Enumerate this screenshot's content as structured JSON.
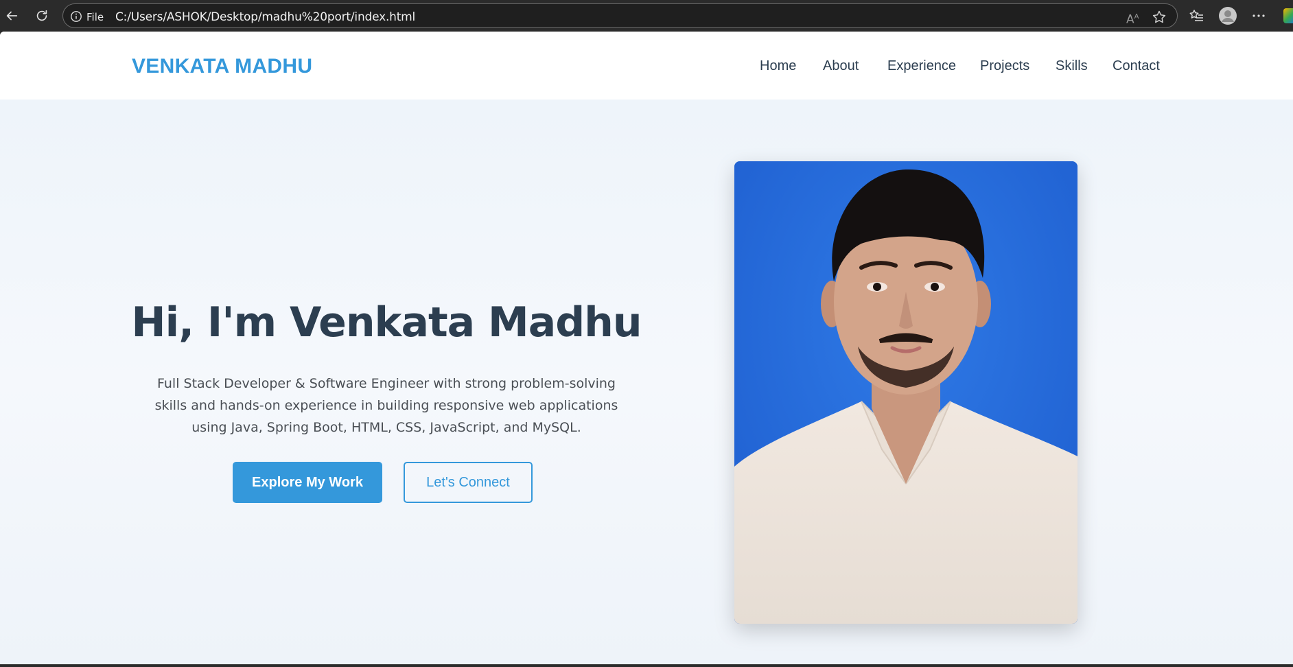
{
  "browser": {
    "file_label": "File",
    "url": "C:/Users/ASHOK/Desktop/madhu%20port/index.html",
    "read_aloud_label": "A",
    "read_aloud_sup": "A"
  },
  "nav": {
    "brand": "VENKATA MADHU",
    "links": [
      "Home",
      "About",
      "Experience",
      "Projects",
      "Skills",
      "Contact"
    ]
  },
  "hero": {
    "title": "Hi, I'm Venkata Madhu",
    "description": "Full Stack Developer & Software Engineer with strong problem-solving skills and hands-on experience in building responsive web applications using Java, Spring Boot, HTML, CSS, JavaScript, and MySQL.",
    "primary_button": "Explore My Work",
    "secondary_button": "Let's Connect"
  },
  "colors": {
    "accent": "#3498db",
    "heading": "#2c3e50",
    "photo_background": "#2b6fd8"
  }
}
